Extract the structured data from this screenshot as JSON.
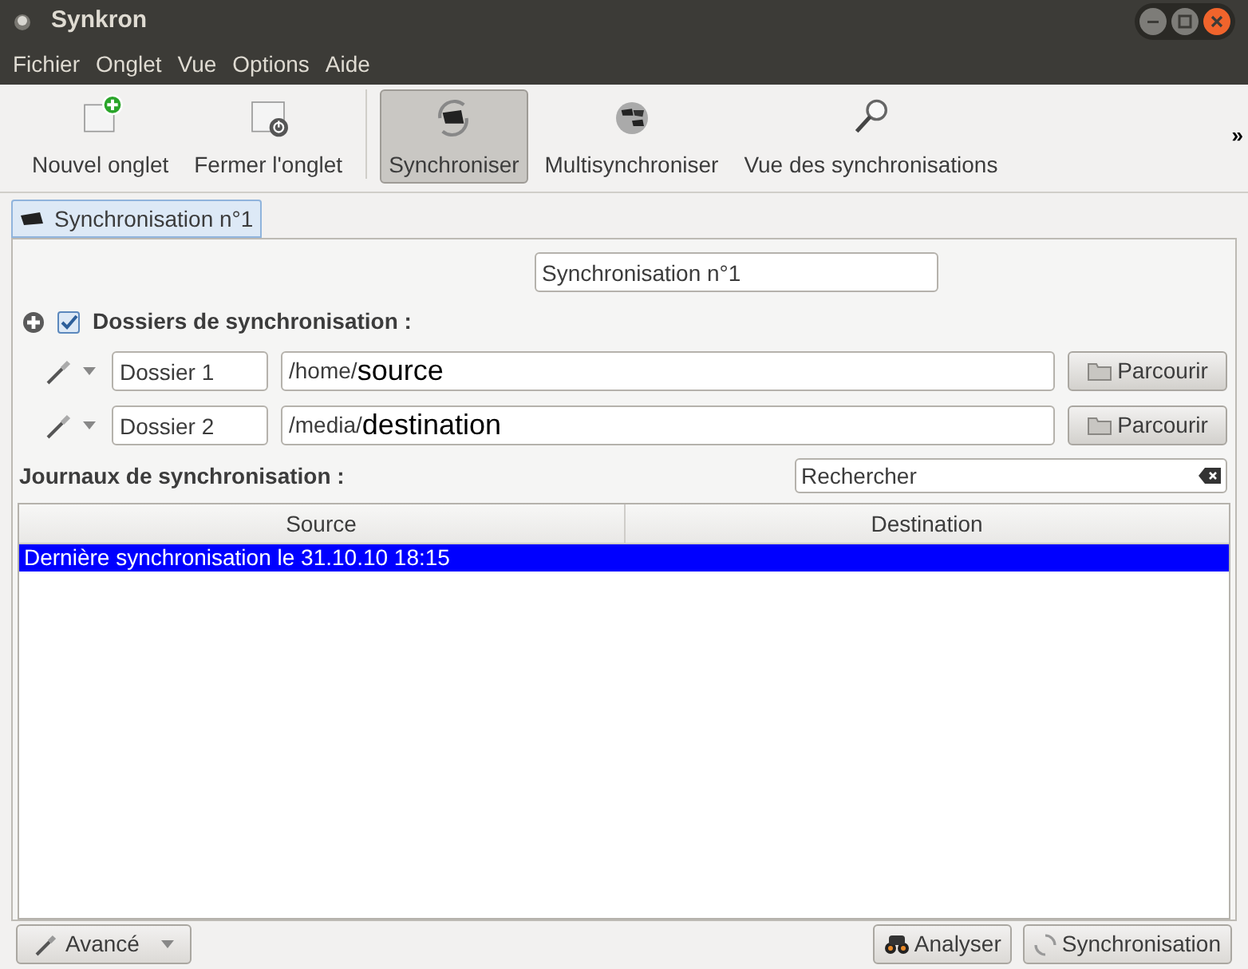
{
  "window": {
    "title": "Synkron"
  },
  "menu": [
    "Fichier",
    "Onglet",
    "Vue",
    "Options",
    "Aide"
  ],
  "toolbar": [
    {
      "label": "Nouvel onglet",
      "kind": "new",
      "selected": false
    },
    {
      "label": "Fermer l'onglet",
      "kind": "close",
      "selected": false
    },
    {
      "label": "Synchroniser",
      "kind": "sync",
      "selected": true
    },
    {
      "label": "Multisynchroniser",
      "kind": "multi",
      "selected": false
    },
    {
      "label": "Vue des synchronisations",
      "kind": "view",
      "selected": false
    }
  ],
  "toolbar_overflow": "»",
  "tabs": [
    {
      "label": "Synchronisation n°1",
      "selected": true
    }
  ],
  "sync_name": "Synchronisation n°1",
  "folders_section": {
    "label": "Dossiers de synchronisation :",
    "checked": true
  },
  "folders": [
    {
      "label": "Dossier 1",
      "path_prefix": "/home/",
      "path": "source",
      "button": "Parcourir"
    },
    {
      "label": "Dossier 2",
      "path_prefix": "/media/",
      "path": "destination",
      "button": "Parcourir"
    }
  ],
  "logs": {
    "label": "Journaux de synchronisation :",
    "search_placeholder": "Rechercher"
  },
  "table": {
    "columns": [
      "Source",
      "Destination"
    ],
    "rows": [
      {
        "text": "Dernière synchronisation le 31.10.10 18:15",
        "selected": true
      }
    ]
  },
  "bottom": {
    "advanced": "Avancé",
    "analyse": "Analyser",
    "sync": "Synchronisation"
  }
}
